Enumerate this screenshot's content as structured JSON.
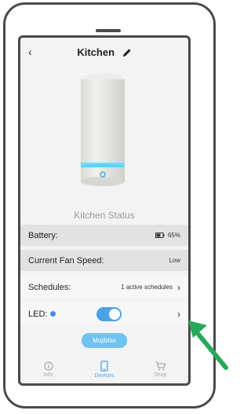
{
  "header": {
    "title": "Kitchen"
  },
  "status": {
    "title": "Kitchen Status"
  },
  "rows": {
    "battery": {
      "label": "Battery:",
      "value": "65%"
    },
    "fan_speed": {
      "label": "Current Fan Speed:",
      "value": "Low"
    },
    "schedules": {
      "label": "Schedules:",
      "value": "1 active schedules"
    },
    "led": {
      "label": "LED:",
      "toggle_on": true,
      "dot_color": "#3f8ee0"
    }
  },
  "actions": {
    "mojimax_label": "MojiMax"
  },
  "tabbar": {
    "tabs": [
      {
        "label": "Info",
        "icon": "info-icon",
        "active": false
      },
      {
        "label": "Devices",
        "icon": "phone-icon",
        "active": true
      },
      {
        "label": "Shop",
        "icon": "cart-icon",
        "active": false
      }
    ]
  },
  "colors": {
    "accent": "#4aa3e6",
    "pointer_arrow": "#2aa85a",
    "glow_ring": "#58d2ff"
  }
}
